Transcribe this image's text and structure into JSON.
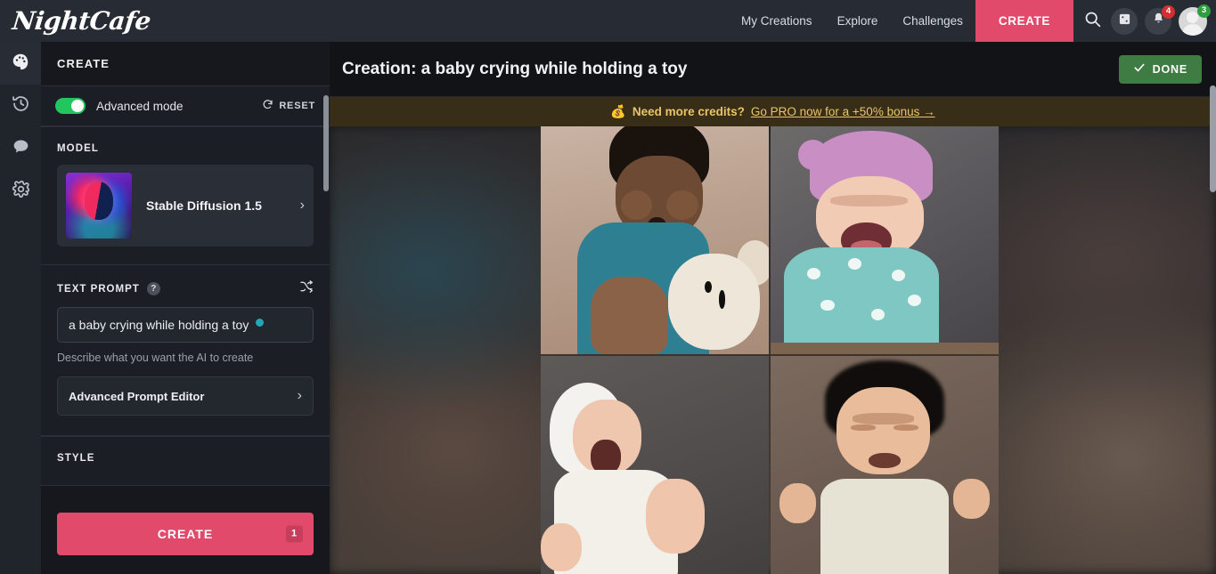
{
  "brand": {
    "logo": "NightCafe"
  },
  "topnav": {
    "links": [
      {
        "label": "My Creations",
        "name": "my-creations"
      },
      {
        "label": "Explore",
        "name": "explore"
      },
      {
        "label": "Challenges",
        "name": "challenges"
      }
    ],
    "create_label": "CREATE",
    "search_icon": "search-icon",
    "dice_icon": "dice-icon",
    "bell_icon": "bell-icon",
    "bell_badge": "4",
    "avatar_badge": "3"
  },
  "rail": {
    "items": [
      {
        "name": "create-palette",
        "icon": "palette-icon",
        "active": true
      },
      {
        "name": "history",
        "icon": "history-clock-icon",
        "active": false
      },
      {
        "name": "messages",
        "icon": "chat-bubble-icon",
        "active": false
      },
      {
        "name": "settings",
        "icon": "gear-icon",
        "active": false
      }
    ]
  },
  "panel": {
    "title": "CREATE",
    "advanced_mode_label": "Advanced mode",
    "advanced_mode_on": true,
    "reset_label": "RESET",
    "reset_icon": "refresh-icon",
    "model": {
      "section_label": "MODEL",
      "name": "Stable Diffusion 1.5",
      "chevron": "chevron-right-icon"
    },
    "prompt": {
      "section_label": "TEXT PROMPT",
      "help_glyph": "?",
      "shuffle_icon": "shuffle-icon",
      "value": "a baby crying while holding a toy",
      "placeholder": "Describe what you want the AI to create",
      "helper": "Describe what you want the AI to create",
      "advanced_editor_label": "Advanced Prompt Editor",
      "dot_color": "#23a6b8"
    },
    "style": {
      "section_label": "STYLE"
    },
    "create_button": {
      "label": "CREATE",
      "credits": "1"
    }
  },
  "main": {
    "title": "Creation: a baby crying while holding a toy",
    "done_label": "DONE",
    "done_icon": "check-icon",
    "banner": {
      "emoji": "💰",
      "bold_text": "Need more credits?",
      "link_text": "Go PRO now for a +50% bonus →"
    },
    "images": [
      {
        "name": "generated-image-1",
        "alt": "baby in teal shirt crying holding white plush toy"
      },
      {
        "name": "generated-image-2",
        "alt": "baby in pink knit hat and teal polka dot outfit crying"
      },
      {
        "name": "generated-image-3",
        "alt": "newborn in white bonnet and onesie yawning"
      },
      {
        "name": "generated-image-4",
        "alt": "dark haired baby in cream onesie crying"
      }
    ]
  },
  "colors": {
    "accent_pink": "#e24a6b",
    "toggle_green": "#22c55e",
    "done_green": "#3f7c43",
    "banner_bg": "#382e18",
    "banner_text": "#e8c46a"
  }
}
